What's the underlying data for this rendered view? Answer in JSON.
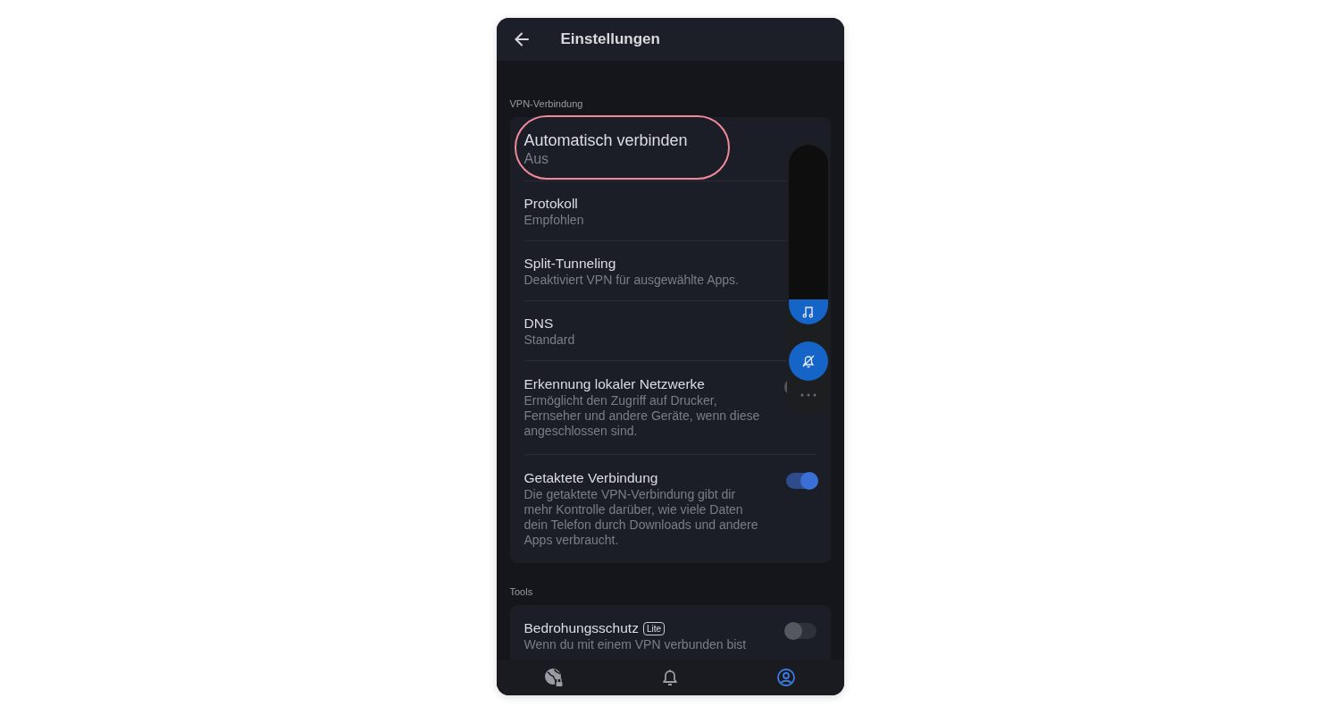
{
  "header": {
    "title": "Einstellungen"
  },
  "sections": [
    {
      "title": "VPN-Verbindung",
      "items": [
        {
          "kind": "link",
          "title": "Automatisch verbinden",
          "subtitle": "Aus",
          "highlighted": true
        },
        {
          "kind": "link",
          "title": "Protokoll",
          "subtitle": "Empfohlen",
          "highlighted": false
        },
        {
          "kind": "link",
          "title": "Split-Tunneling",
          "subtitle": "Deaktiviert VPN für ausgewählte Apps.",
          "highlighted": false
        },
        {
          "kind": "link",
          "title": "DNS",
          "subtitle": "Standard",
          "highlighted": false
        },
        {
          "kind": "toggle",
          "title": "Erkennung lokaler Netzwerke",
          "subtitle": "Ermöglicht den Zugriff auf Drucker, Fernseher und andere Geräte, wenn diese angeschlossen sind.",
          "on": false,
          "highlighted": false
        },
        {
          "kind": "toggle",
          "title": "Getaktete Verbindung",
          "subtitle": "Die getaktete VPN-Verbindung gibt dir mehr Kontrolle darüber, wie viele Daten dein Telefon durch Downloads und andere Apps verbraucht.",
          "on": true,
          "highlighted": false
        }
      ]
    },
    {
      "title": "Tools",
      "items": [
        {
          "kind": "toggle",
          "title": "Bedrohungsschutz",
          "badge": "Lite",
          "subtitle": "Wenn du mit einem VPN verbunden bist",
          "on": false,
          "highlighted": false
        }
      ]
    }
  ],
  "volume_panel": {
    "level": 0.14
  },
  "nav": [
    {
      "kind": "globe-lock",
      "selected": false
    },
    {
      "kind": "bell",
      "selected": false
    },
    {
      "kind": "account",
      "selected": true
    }
  ]
}
